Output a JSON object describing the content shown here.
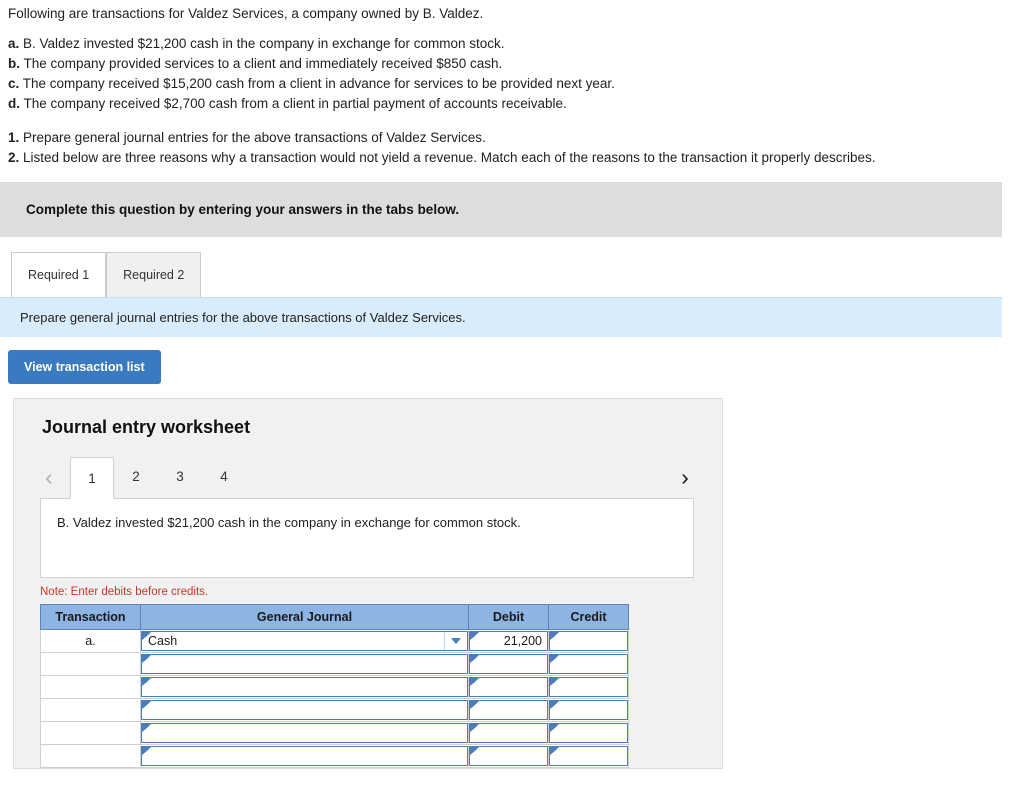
{
  "intro": {
    "lead": "Following are transactions for Valdez Services, a company owned by B. Valdez.",
    "transactions": [
      {
        "letter": "a.",
        "text": "B. Valdez invested $21,200 cash in the company in exchange for common stock."
      },
      {
        "letter": "b.",
        "text": "The company provided services to a client and immediately received $850 cash."
      },
      {
        "letter": "c.",
        "text": "The company received $15,200 cash from a client in advance for services to be provided next year."
      },
      {
        "letter": "d.",
        "text": "The company received $2,700 cash from a client in partial payment of accounts receivable."
      }
    ],
    "requirements": [
      {
        "num": "1.",
        "text": "Prepare general journal entries for the above transactions of Valdez Services."
      },
      {
        "num": "2.",
        "text": "Listed below are three reasons why a transaction would not yield a revenue. Match each of the reasons to the transaction it properly describes."
      }
    ]
  },
  "banner": {
    "text": "Complete this question by entering your answers in the tabs below."
  },
  "tabs": [
    {
      "label": "Required 1",
      "active": true
    },
    {
      "label": "Required 2",
      "active": false
    }
  ],
  "instruction_bar": {
    "text": "Prepare general journal entries for the above transactions of Valdez Services."
  },
  "view_transaction_button": {
    "label": "View transaction list"
  },
  "worksheet": {
    "title": "Journal entry worksheet",
    "prev_arrow": "‹",
    "next_arrow": "›",
    "pages": [
      {
        "label": "1",
        "active": true
      },
      {
        "label": "2",
        "active": false
      },
      {
        "label": "3",
        "active": false
      },
      {
        "label": "4",
        "active": false
      }
    ],
    "description": "B. Valdez invested $21,200 cash in the company in exchange for common stock.",
    "note": "Note: Enter debits before credits.",
    "table": {
      "headers": [
        "Transaction",
        "General Journal",
        "Debit",
        "Credit"
      ],
      "rows": [
        {
          "transaction": "a.",
          "account": "Cash",
          "has_dropdown": true,
          "debit": "21,200",
          "credit": ""
        },
        {
          "transaction": "",
          "account": "",
          "has_dropdown": false,
          "debit": "",
          "credit": ""
        },
        {
          "transaction": "",
          "account": "",
          "has_dropdown": false,
          "debit": "",
          "credit": ""
        },
        {
          "transaction": "",
          "account": "",
          "has_dropdown": false,
          "debit": "",
          "credit": ""
        },
        {
          "transaction": "",
          "account": "",
          "has_dropdown": false,
          "debit": "",
          "credit": ""
        },
        {
          "transaction": "",
          "account": "",
          "has_dropdown": false,
          "debit": "",
          "credit": ""
        }
      ]
    }
  },
  "colors": {
    "banner_gray": "#dddddd",
    "instruction_blue": "#d9ecfb",
    "button_blue": "#3a7ac0",
    "table_header_blue": "#8db4e2",
    "input_border_blue": "#4a7ebb",
    "note_red": "#c0392b",
    "panel_gray": "#f1f1f1"
  }
}
